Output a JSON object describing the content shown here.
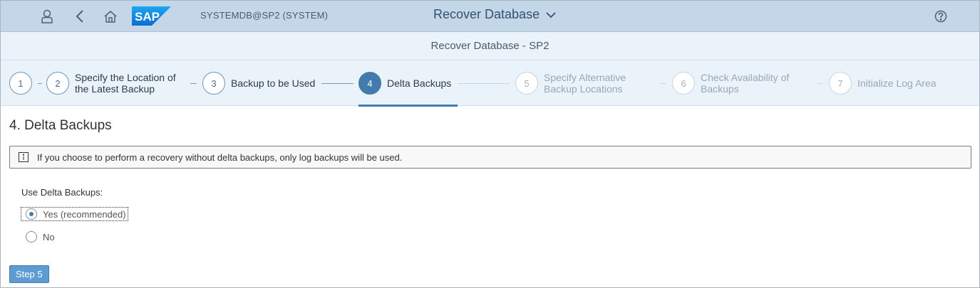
{
  "shell": {
    "system": "SYSTEMDB@SP2 (SYSTEM)",
    "app_title": "Recover Database",
    "icons": [
      "user-icon",
      "back-icon",
      "home-icon",
      "sap-logo",
      "chevron-down-icon",
      "help-icon"
    ],
    "logo_text": "SAP"
  },
  "subheader": {
    "title": "Recover Database - SP2"
  },
  "wizard": {
    "steps": [
      {
        "number": "1",
        "label": "",
        "state": "completed"
      },
      {
        "number": "2",
        "label_line1": "Specify the Location of",
        "label_line2": "the Latest Backup",
        "state": "completed"
      },
      {
        "number": "3",
        "label": "Backup to be Used",
        "state": "completed"
      },
      {
        "number": "4",
        "label": "Delta Backups",
        "state": "active"
      },
      {
        "number": "5",
        "label_line1": "Specify Alternative",
        "label_line2": "Backup Locations",
        "state": "disabled"
      },
      {
        "number": "6",
        "label_line1": "Check Availability of",
        "label_line2": "Backups",
        "state": "disabled"
      },
      {
        "number": "7",
        "label": "Initialize Log Area",
        "state": "disabled"
      }
    ]
  },
  "content": {
    "heading": "4. Delta Backups",
    "info_message": "If you choose to perform a recovery without delta backups, only log backups will be used.",
    "group_label": "Use Delta Backups:",
    "options": [
      {
        "label": "Yes (recommended)",
        "selected": true
      },
      {
        "label": "No",
        "selected": false
      }
    ],
    "next_button": "Step 5"
  },
  "colors": {
    "accent": "#427cac",
    "shell_bg": "#c4d7e8",
    "wizard_bg": "#eaf2fa",
    "button_bg": "#5d9bd2"
  }
}
